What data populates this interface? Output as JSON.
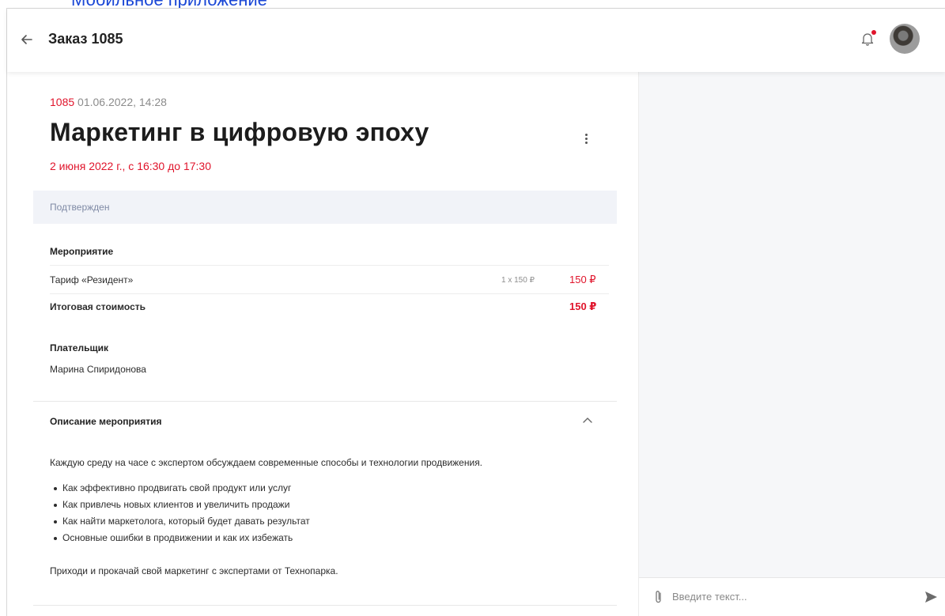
{
  "browser_link": "Мобильное приложение",
  "header": {
    "title": "Заказ 1085"
  },
  "order": {
    "number": "1085",
    "created": "01.06.2022, 14:28",
    "event_title": "Маркетинг в цифровую эпоху",
    "event_date": "2 июня 2022 г., с 16:30 до 17:30",
    "status": "Подтвержден"
  },
  "event_section": {
    "label": "Мероприятие",
    "items": [
      {
        "name": "Тариф «Резидент»",
        "qty": "1 x 150 ₽",
        "price": "150 ₽"
      }
    ],
    "total_label": "Итоговая стоимость",
    "total_value": "150 ₽"
  },
  "payer": {
    "label": "Плательщик",
    "name": "Марина Спиридонова"
  },
  "description": {
    "label": "Описание мероприятия",
    "intro": "Каждую среду на часе с экспертом обсуждаем современные способы и технологии продвижения.",
    "bullets": [
      "Как эффективно продвигать свой продукт или услуг",
      "Как привлечь новых клиентов и увеличить продажи",
      "Как найти маркетолога, который будет давать результат",
      "Основные ошибки в продвижении и как их избежать"
    ],
    "outro": "Приходи и прокачай свой маркетинг с экспертами от Технопарка."
  },
  "chat": {
    "placeholder": "Введите текст..."
  },
  "colors": {
    "accent": "#e0142b",
    "status_bg": "#f1f3f8",
    "link": "#1a47d6"
  },
  "icons": {
    "back": "arrow-left-icon",
    "notifications": "bell-icon",
    "more": "kebab-icon",
    "collapse": "chevron-up-icon",
    "attach": "paperclip-icon",
    "send": "send-icon"
  }
}
